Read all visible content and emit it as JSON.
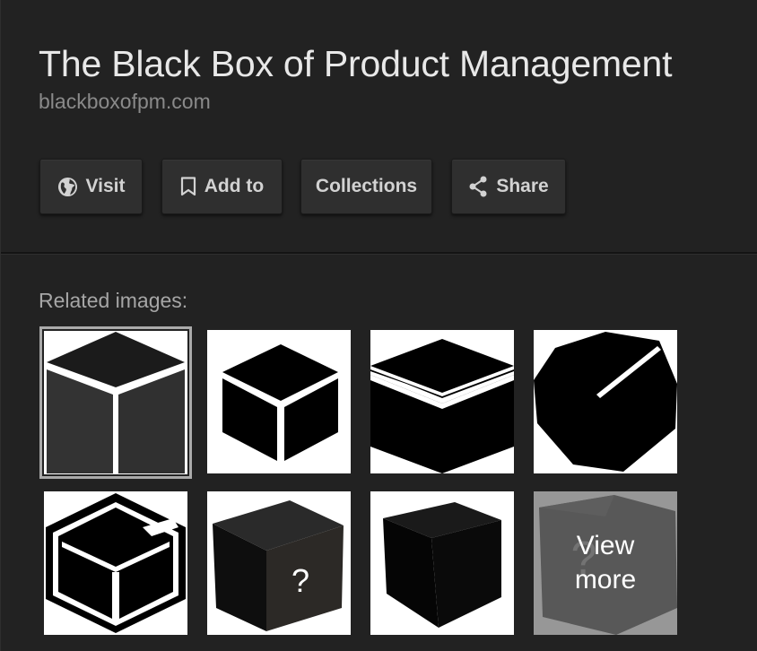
{
  "header": {
    "title": "The Black Box of Product Management",
    "domain": "blackboxofpm.com"
  },
  "actions": {
    "visit": {
      "label": "Visit",
      "icon": "globe-icon"
    },
    "add_to": {
      "label": "Add to",
      "icon": "bookmark-icon"
    },
    "collections": {
      "label": "Collections"
    },
    "share": {
      "label": "Share",
      "icon": "share-icon"
    }
  },
  "related": {
    "label": "Related images:",
    "thumbnails": [
      {
        "name": "gray-cube-selected",
        "selected": true
      },
      {
        "name": "black-cube-white-edges"
      },
      {
        "name": "black-box-open-lid"
      },
      {
        "name": "tilted-cube-slit"
      },
      {
        "name": "outlined-box-open"
      },
      {
        "name": "question-mark-box",
        "mark": "?"
      },
      {
        "name": "shaded-black-cube"
      },
      {
        "name": "view-more-cube",
        "mark": "?"
      }
    ],
    "view_more": "View more"
  },
  "colors": {
    "background": "#222222",
    "button_bg": "#2f2f2f",
    "title_text": "#e8e8e8",
    "domain_text": "#8a8a8a"
  }
}
